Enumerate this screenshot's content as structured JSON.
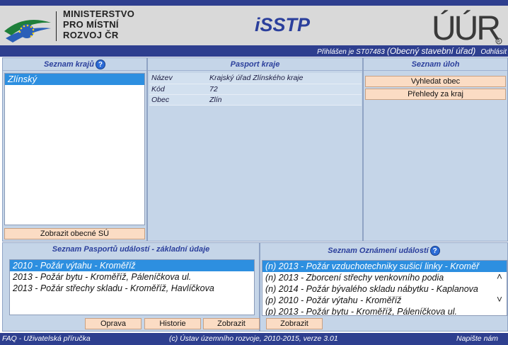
{
  "header": {
    "ministry_line1": "MINISTERSTVO",
    "ministry_line2": "PRO MÍSTNÍ",
    "ministry_line3": "ROZVOJ ČR",
    "app_title": "iSSTP",
    "uur_logo_text": "ÚÚR"
  },
  "userbar": {
    "prefix": "Přihlášen je ST07483",
    "role": "(Obecný stavební úřad)",
    "logout": "Odhlásit"
  },
  "kraje": {
    "title": "Seznam krajů",
    "items": [
      "Zlínský"
    ],
    "selected_index": 0,
    "button": "Zobrazit obecné SÚ"
  },
  "pasport": {
    "title": "Pasport kraje",
    "rows": [
      {
        "key": "Název",
        "value": "Krajský úřad Zlínského kraje"
      },
      {
        "key": "Kód",
        "value": "72"
      },
      {
        "key": "Obec",
        "value": "Zlín"
      }
    ]
  },
  "ulohy": {
    "title": "Seznam úloh",
    "buttons": [
      "Vyhledat obec",
      "Přehledy za kraj"
    ]
  },
  "pasporty_udalosti": {
    "title": "Seznam Pasportů událostí - základní údaje",
    "items": [
      "2010 - Požár výtahu - Kroměříž",
      "2013 - Požár bytu - Kroměříž, Páleníčkova ul.",
      "2013 - Požár střechy skladu - Kroměříž, Havlíčkova"
    ],
    "selected_index": 0,
    "buttons": [
      "Oprava",
      "Historie",
      "Zobrazit"
    ]
  },
  "oznameni_udalosti": {
    "title": "Seznam Oznámení událostí",
    "items": [
      "(n) 2013 - Požár vzduchotechniky sušicí linky - Kroměř",
      "(n) 2013 - Zborcení střechy venkovního podia",
      "(n) 2014 - Požár bývalého skladu nábytku - Kaplanova",
      "(p) 2010 - Požár výtahu - Kroměříž",
      "(p) 2013 - Požár bytu - Kroměříž, Páleníčkova ul."
    ],
    "selected_index": 0,
    "button": "Zobrazit"
  },
  "footer": {
    "left": "FAQ - Uživatelská příručka",
    "center": "(c) Ústav územního rozvoje, 2010-2015, verze 3.01",
    "right": "Napište nám"
  },
  "colors": {
    "navy": "#2e3f8f",
    "panel": "#c5d5e8",
    "selection": "#2d8fe0",
    "button": "#fbdcc4"
  }
}
